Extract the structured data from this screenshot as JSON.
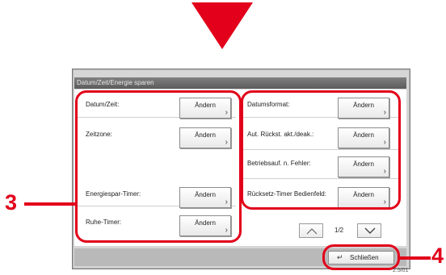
{
  "window_title": "Datum/Zeit/Energie sparen",
  "left_settings": [
    {
      "label": "Datum/Zeit:",
      "button": "Ändern"
    },
    {
      "label": "Zeitzone:",
      "button": "Ändern"
    },
    {
      "label": "Energiespar-Timer:",
      "button": "Ändern"
    },
    {
      "label": "Ruhe-Timer:",
      "button": "Ändern"
    }
  ],
  "right_settings": [
    {
      "label": "Datumsformat:",
      "button": "Ändern"
    },
    {
      "label": "Aut. Rückst. akt./deak.:",
      "button": "Ändern"
    },
    {
      "label": "Betriebsauf. n. Fehler:",
      "button": "Ändern"
    },
    {
      "label": "Rücksetz-Timer Bedienfeld:",
      "button": "Ändern"
    }
  ],
  "pagination": {
    "page": "1/2"
  },
  "close_button": "Schließen",
  "callouts": {
    "three": "3",
    "four": "4"
  },
  "figure_code": "2.5/01",
  "colors": {
    "accent": "#e2001a",
    "titlebar": "#6a6a6a"
  }
}
